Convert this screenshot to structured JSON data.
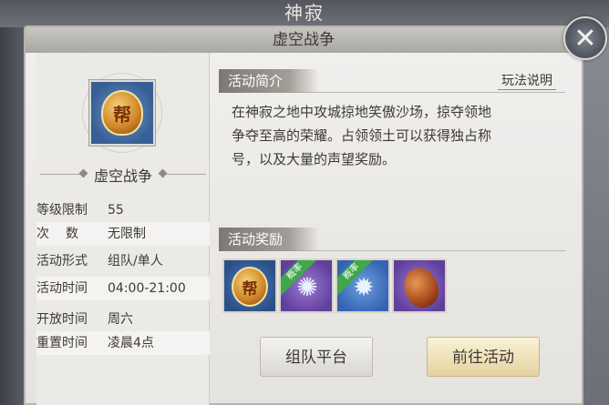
{
  "window": {
    "outer_title": "神寂",
    "panel_title": "虚空战争"
  },
  "activity": {
    "name": "虚空战争",
    "emblem_char": "帮",
    "info": [
      {
        "key": "等级限制",
        "value": "55"
      },
      {
        "key": "次数",
        "value": "无限制"
      },
      {
        "key": "活动形式",
        "value": "组队/单人"
      },
      {
        "key": "活动时间",
        "value": "04:00-21:00"
      },
      {
        "key": "开放时间",
        "value": "周六"
      },
      {
        "key": "重置时间",
        "value": "凌晨4点"
      }
    ]
  },
  "intro": {
    "title": "活动简介",
    "help_label": "玩法说明",
    "lines": [
      "在神寂之地中攻城掠地笑傲沙场，掠夺领地",
      "争夺至高的荣耀。占领领土可以获得独占称",
      "号，以及大量的声望奖励。"
    ]
  },
  "rewards": {
    "title": "活动奖励",
    "items": [
      {
        "icon": "guild-coin-icon",
        "char": "帮",
        "tag": ""
      },
      {
        "icon": "purple-rune-icon",
        "char": "",
        "tag": "概率"
      },
      {
        "icon": "blue-rune-icon",
        "char": "",
        "tag": "概率"
      },
      {
        "icon": "red-egg-icon",
        "char": "",
        "tag": ""
      }
    ]
  },
  "buttons": {
    "team_label": "组队平台",
    "go_label": "前往活动"
  },
  "close_glyph": "✕"
}
